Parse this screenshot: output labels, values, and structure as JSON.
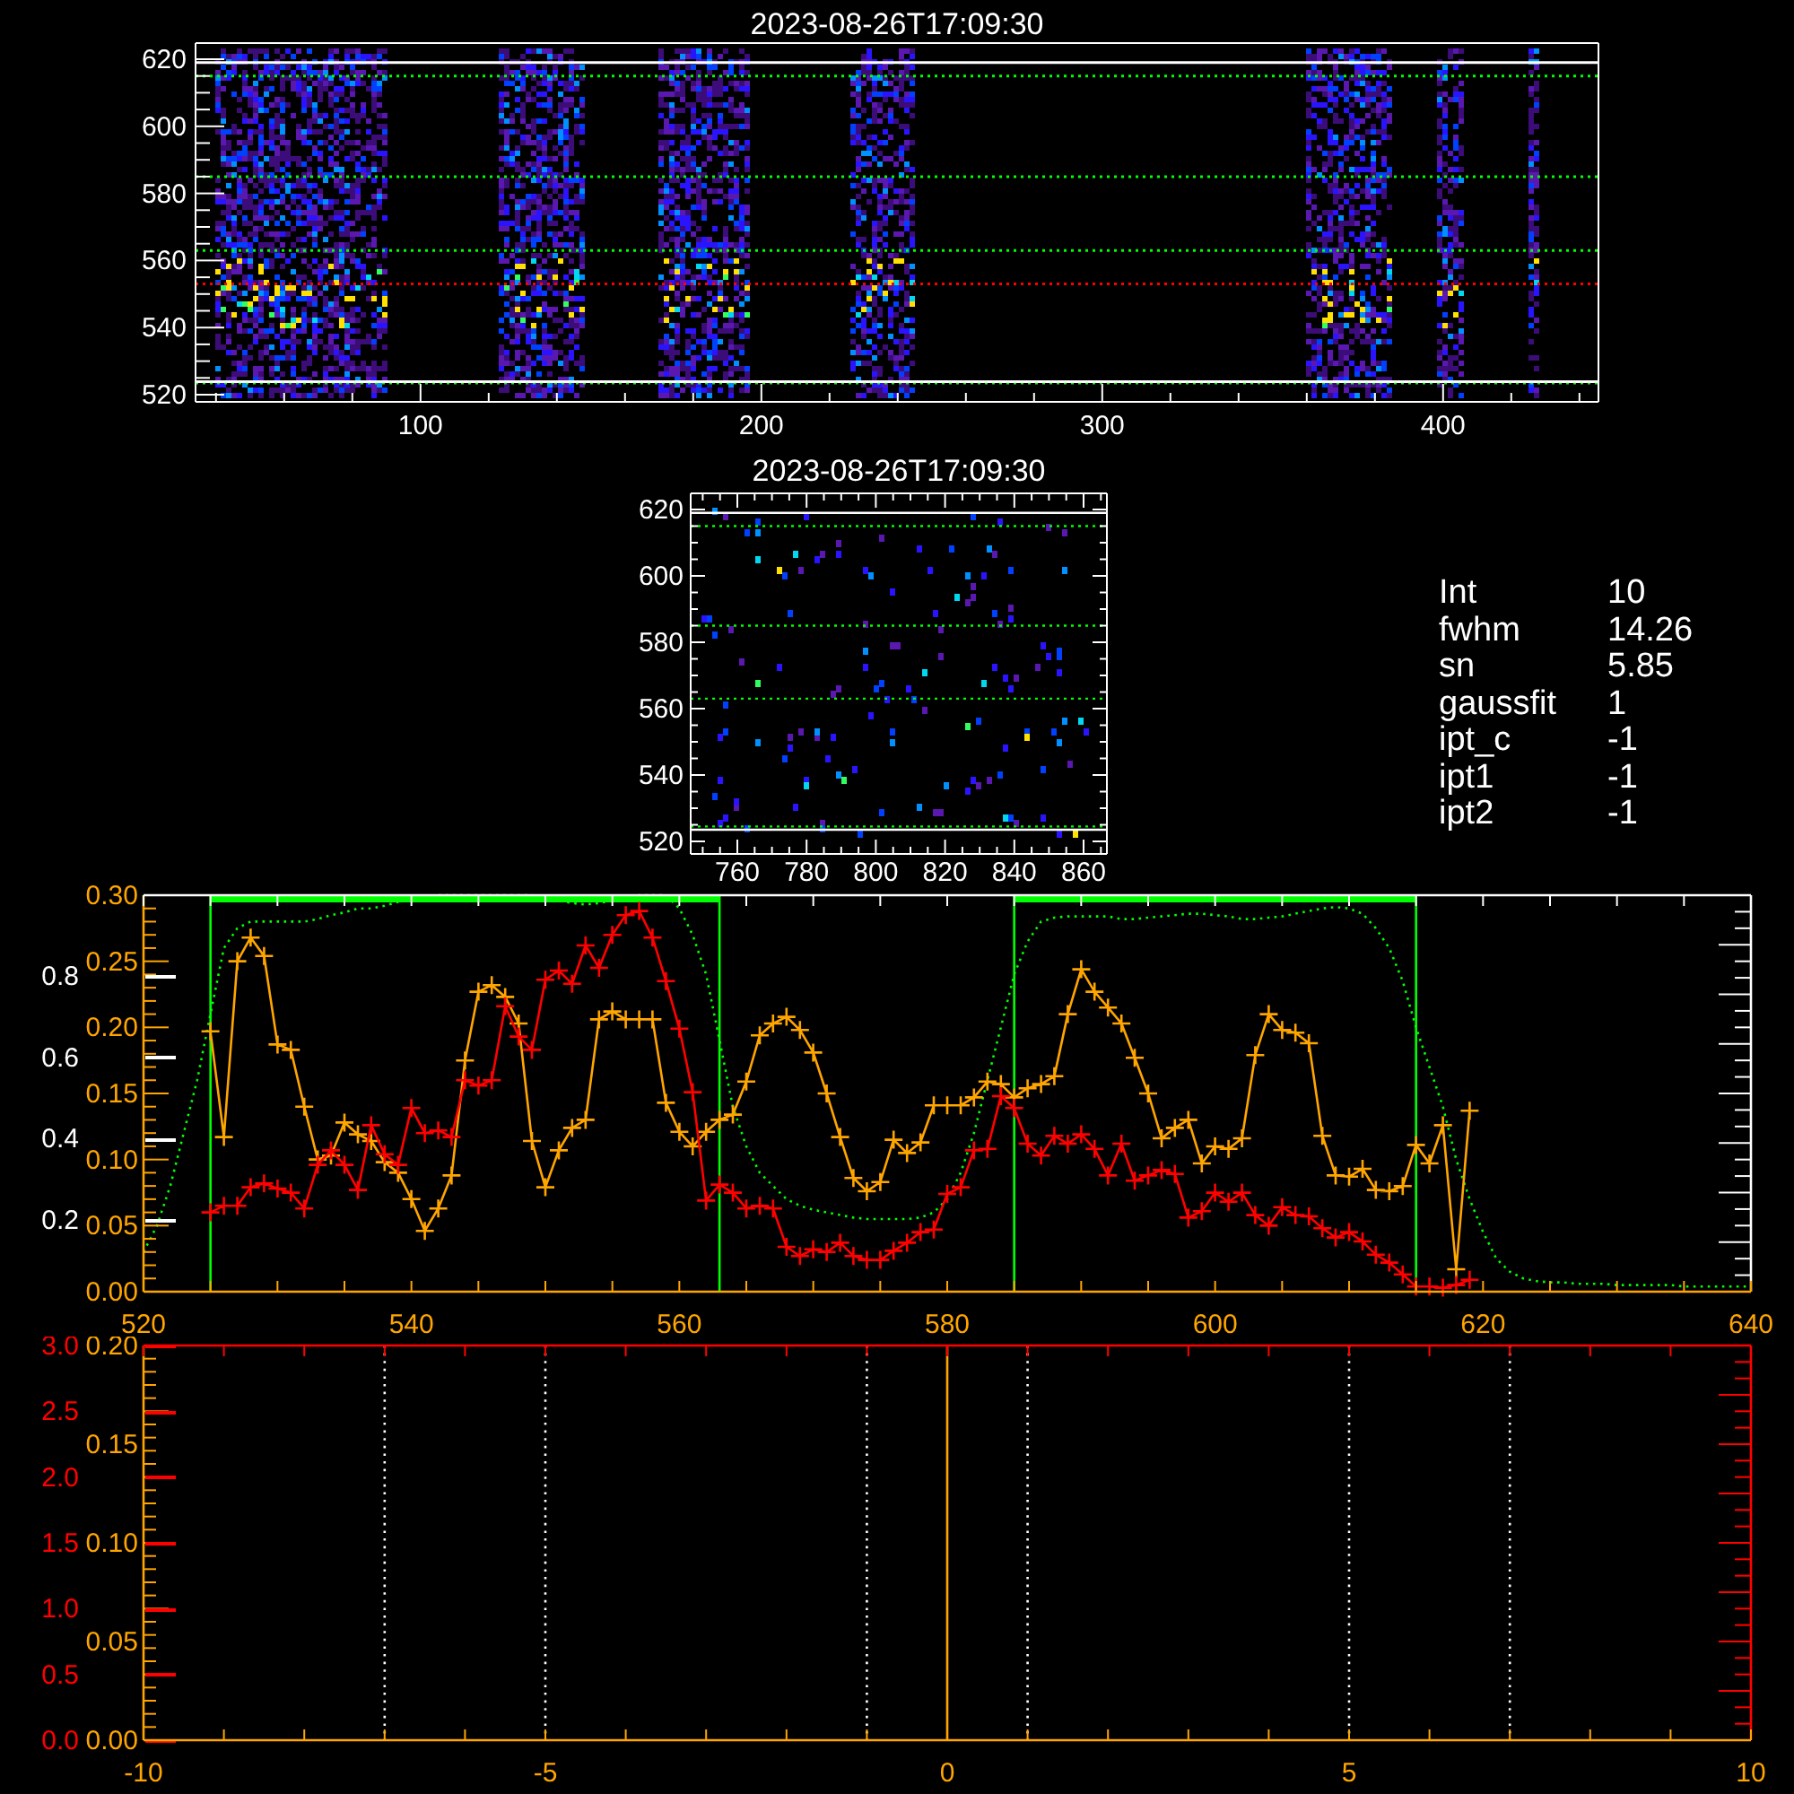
{
  "top_image": {
    "title": "2023-08-26T17:09:30",
    "x_tick_labels": [
      "100",
      "200",
      "300",
      "400"
    ],
    "y_tick_labels": [
      "620",
      "600",
      "580",
      "560",
      "540",
      "520"
    ]
  },
  "detail_image": {
    "title": "2023-08-26T17:09:30",
    "x_tick_labels": [
      "760",
      "780",
      "800",
      "820",
      "840",
      "860"
    ],
    "y_tick_labels": [
      "620",
      "600",
      "580",
      "560",
      "540",
      "520"
    ]
  },
  "fit_info": [
    {
      "label": "Int",
      "value": "10"
    },
    {
      "label": "fwhm",
      "value": "14.26"
    },
    {
      "label": "sn",
      "value": "5.85"
    },
    {
      "label": "gaussfit",
      "value": "1"
    },
    {
      "label": "ipt_c",
      "value": "-1"
    },
    {
      "label": "ipt1",
      "value": "-1"
    },
    {
      "label": "ipt2",
      "value": "-1"
    }
  ],
  "spectrum_plot": {
    "chart_data": {
      "type": "line",
      "xlim": [
        520,
        640
      ],
      "ylim": [
        0,
        0.3
      ],
      "xticks": [
        {
          "value": 520,
          "label": "520"
        },
        {
          "value": 540,
          "label": "540"
        },
        {
          "value": 560,
          "label": "560"
        },
        {
          "value": 580,
          "label": "580"
        },
        {
          "value": 600,
          "label": "600"
        },
        {
          "value": 620,
          "label": "620"
        },
        {
          "value": 640,
          "label": "640"
        }
      ],
      "yticks": [
        {
          "value": 0,
          "label": "0.00"
        },
        {
          "value": 0.05,
          "label": "0.05"
        },
        {
          "value": 0.1,
          "label": "0.10"
        },
        {
          "value": 0.15,
          "label": "0.15"
        },
        {
          "value": 0.2,
          "label": "0.20"
        },
        {
          "value": 0.25,
          "label": "0.25"
        },
        {
          "value": 0.3,
          "label": "0.30"
        }
      ],
      "x": [
        520,
        521,
        522,
        523,
        524,
        525,
        526,
        527,
        528,
        529,
        530,
        531,
        532,
        533,
        534,
        535,
        536,
        537,
        538,
        539,
        540,
        541,
        542,
        543,
        544,
        545,
        546,
        547,
        548,
        549,
        550,
        551,
        552,
        553,
        554,
        555,
        556,
        557,
        558,
        559,
        560,
        561,
        562,
        563,
        564,
        565,
        566,
        567,
        568,
        569,
        570,
        571,
        572,
        573,
        574,
        575,
        576,
        577,
        578,
        579,
        580,
        581,
        582,
        583,
        584,
        585,
        586,
        587,
        588,
        589,
        590,
        591,
        592,
        593,
        594,
        595,
        596,
        597,
        598,
        599,
        600,
        601,
        602,
        603,
        604,
        605,
        606,
        607,
        608,
        609,
        610,
        611,
        612,
        613,
        614,
        615,
        616,
        617,
        618,
        619,
        620,
        621,
        622,
        623,
        624,
        625,
        626,
        627,
        628,
        629,
        630,
        631,
        632,
        633,
        634,
        635,
        636,
        637,
        638,
        639,
        640
      ],
      "series": [
        {
          "color": "#00ff00",
          "line_style": "dotted",
          "values": [
            0.03,
            0.05,
            0.08,
            0.12,
            0.16,
            0.21,
            0.26,
            0.275,
            0.28,
            0.28,
            0.28,
            0.28,
            0.28,
            0.282,
            0.285,
            0.287,
            0.29,
            0.29,
            0.292,
            0.295,
            0.297,
            0.298,
            0.3,
            0.3,
            0.3,
            0.3,
            0.3,
            0.3,
            0.3,
            0.3,
            0.298,
            0.296,
            0.294,
            0.293,
            0.294,
            0.296,
            0.298,
            0.3,
            0.3,
            0.3,
            0.29,
            0.27,
            0.24,
            0.19,
            0.14,
            0.11,
            0.09,
            0.08,
            0.07,
            0.065,
            0.062,
            0.06,
            0.058,
            0.056,
            0.055,
            0.055,
            0.055,
            0.055,
            0.056,
            0.06,
            0.07,
            0.09,
            0.12,
            0.16,
            0.2,
            0.24,
            0.265,
            0.28,
            0.283,
            0.284,
            0.284,
            0.284,
            0.284,
            0.282,
            0.282,
            0.283,
            0.284,
            0.285,
            0.286,
            0.286,
            0.285,
            0.284,
            0.282,
            0.282,
            0.283,
            0.284,
            0.286,
            0.288,
            0.29,
            0.291,
            0.29,
            0.286,
            0.275,
            0.26,
            0.235,
            0.2,
            0.17,
            0.14,
            0.1,
            0.07,
            0.045,
            0.025,
            0.015,
            0.01,
            0.008,
            0.007,
            0.007,
            0.006,
            0.006,
            0.006,
            0.005,
            0.005,
            0.005,
            0.005,
            0.005,
            0.004,
            0.004,
            0.004,
            0.004,
            0.004,
            0.004
          ]
        },
        {
          "color": "#ffa500",
          "marker": "plus",
          "values": [
            null,
            null,
            null,
            null,
            null,
            0.197,
            0.117,
            0.25,
            0.268,
            0.254,
            0.187,
            0.183,
            0.14,
            0.1,
            0.103,
            0.128,
            0.119,
            0.114,
            0.098,
            0.09,
            0.07,
            0.046,
            0.063,
            0.088,
            0.175,
            0.227,
            0.232,
            0.223,
            0.203,
            0.114,
            0.079,
            0.107,
            0.124,
            0.13,
            0.206,
            0.212,
            0.206,
            0.206,
            0.206,
            0.143,
            0.121,
            0.11,
            0.121,
            0.13,
            0.134,
            0.159,
            0.194,
            0.203,
            0.208,
            0.198,
            0.181,
            0.15,
            0.117,
            0.086,
            0.076,
            0.083,
            0.115,
            0.105,
            0.113,
            0.141,
            0.141,
            0.141,
            0.147,
            0.159,
            0.157,
            0.147,
            0.154,
            0.157,
            0.163,
            0.21,
            0.244,
            0.227,
            0.215,
            0.203,
            0.177,
            0.15,
            0.116,
            0.124,
            0.13,
            0.097,
            0.11,
            0.108,
            0.116,
            0.179,
            0.21,
            0.198,
            0.196,
            0.188,
            0.118,
            0.088,
            0.087,
            0.093,
            0.077,
            0.076,
            0.08,
            0.111,
            0.097,
            0.126,
            0.017,
            0.137,
            null,
            null,
            null,
            null,
            null,
            null,
            null,
            null,
            null,
            null,
            null,
            null,
            null,
            null,
            null,
            null,
            null,
            null,
            null,
            null,
            null
          ]
        },
        {
          "color": "#ff0000",
          "marker": "plus",
          "values": [
            null,
            null,
            null,
            null,
            null,
            0.06,
            0.065,
            0.065,
            0.079,
            0.082,
            0.078,
            0.075,
            0.063,
            0.096,
            0.107,
            0.096,
            0.077,
            0.126,
            0.104,
            0.096,
            0.139,
            0.12,
            0.122,
            0.117,
            0.16,
            0.156,
            0.16,
            0.216,
            0.193,
            0.183,
            0.236,
            0.243,
            0.233,
            0.262,
            0.245,
            0.27,
            0.285,
            0.288,
            0.268,
            0.235,
            0.199,
            0.151,
            0.069,
            0.081,
            0.075,
            0.063,
            0.065,
            0.063,
            0.034,
            0.027,
            0.032,
            0.03,
            0.037,
            0.027,
            0.024,
            0.024,
            0.031,
            0.037,
            0.045,
            0.047,
            0.074,
            0.079,
            0.107,
            0.108,
            0.148,
            0.139,
            0.112,
            0.103,
            0.118,
            0.112,
            0.119,
            0.108,
            0.088,
            0.112,
            0.084,
            0.088,
            0.092,
            0.089,
            0.056,
            0.061,
            0.075,
            0.068,
            0.075,
            0.058,
            0.05,
            0.064,
            0.058,
            0.057,
            0.048,
            0.041,
            0.045,
            0.038,
            0.028,
            0.022,
            0.013,
            0.004,
            0.004,
            0.003,
            0.005,
            0.009,
            null,
            null,
            null,
            null,
            null,
            null,
            null,
            null,
            null,
            null,
            null,
            null,
            null,
            null,
            null,
            null,
            null,
            null,
            null,
            null,
            null
          ]
        }
      ],
      "ref_lines": [
        {
          "axis": "x",
          "value": 525,
          "color": "#00ff00",
          "line_style": "solid"
        },
        {
          "axis": "x",
          "value": 563,
          "color": "#00ff00",
          "line_style": "solid"
        },
        {
          "axis": "x",
          "value": 585,
          "color": "#00ff00",
          "line_style": "solid"
        },
        {
          "axis": "x",
          "value": 615,
          "color": "#00ff00",
          "line_style": "solid"
        }
      ]
    },
    "extra_axes": [
      {
        "color": "#ffffff",
        "ticks": [
          "0.8",
          "0.6",
          "0.4",
          "0.2"
        ]
      }
    ]
  },
  "offset_plot": {
    "chart_data": {
      "type": "line",
      "xlim": [
        -10,
        10
      ],
      "ylim": [
        0,
        0.2
      ],
      "xticks": [
        {
          "value": -10,
          "label": "-10"
        },
        {
          "value": -5,
          "label": "-5"
        },
        {
          "value": 0,
          "label": "0"
        },
        {
          "value": 5,
          "label": "5"
        },
        {
          "value": 10,
          "label": "10"
        }
      ],
      "yticks": [
        {
          "value": 0,
          "label": "0.00"
        },
        {
          "value": 0.05,
          "label": "0.05"
        },
        {
          "value": 0.1,
          "label": "0.10"
        },
        {
          "value": 0.15,
          "label": "0.15"
        },
        {
          "value": 0.2,
          "label": "0.20"
        }
      ],
      "ref_lines": [
        {
          "axis": "x",
          "value": -7,
          "color": "#ffffff",
          "line_style": "dotted"
        },
        {
          "axis": "x",
          "value": -5,
          "color": "#ffffff",
          "line_style": "dotted"
        },
        {
          "axis": "x",
          "value": -1,
          "color": "#ffffff",
          "line_style": "dotted"
        },
        {
          "axis": "x",
          "value": 0,
          "color": "#ffa500",
          "line_style": "solid"
        },
        {
          "axis": "x",
          "value": 1,
          "color": "#ffffff",
          "line_style": "dotted"
        },
        {
          "axis": "x",
          "value": 5,
          "color": "#ffffff",
          "line_style": "dotted"
        },
        {
          "axis": "x",
          "value": 7,
          "color": "#ffffff",
          "line_style": "dotted"
        }
      ]
    },
    "extra_axes": [
      {
        "color": "#ff0000",
        "ticks": [
          "3.0",
          "2.5",
          "2.0",
          "1.5",
          "1.0",
          "0.5",
          "0.0"
        ]
      }
    ]
  }
}
